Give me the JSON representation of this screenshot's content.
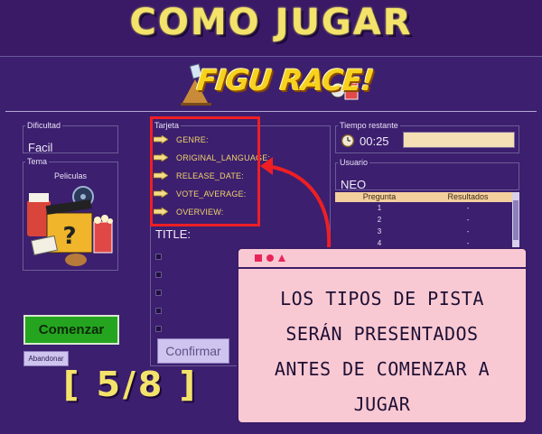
{
  "header": {
    "title": "COMO JUGAR"
  },
  "logo": {
    "text": "FIGU RACE!"
  },
  "dificultad": {
    "legend": "Dificultad",
    "value": "Facil"
  },
  "tema": {
    "legend": "Tema",
    "value": "Peliculas"
  },
  "tarjeta": {
    "legend": "Tarjeta",
    "hints": [
      "GENRE:",
      "ORIGINAL_LANGUAGE:",
      "RELEASE_DATE:",
      "VOTE_AVERAGE:",
      "OVERVIEW:"
    ],
    "title_label": "TITLE:"
  },
  "tiempo": {
    "legend": "Tiempo restante",
    "value": "00:25"
  },
  "usuario": {
    "legend": "Usuario",
    "value": "NEO"
  },
  "resultados": {
    "headers": [
      "Pregunta",
      "Resultados"
    ],
    "rows": [
      [
        "1",
        "-"
      ],
      [
        "2",
        "-"
      ],
      [
        "3",
        "-"
      ],
      [
        "4",
        "-"
      ]
    ]
  },
  "buttons": {
    "start": "Comenzar",
    "quit": "Abandonar",
    "confirm": "Confirmar"
  },
  "step": "[ 5/8 ]",
  "popup": {
    "lines": [
      "LOS TIPOS DE PISTA",
      "SERÁN PRESENTADOS",
      "ANTES DE COMENZAR A",
      "JUGAR"
    ]
  },
  "colors": {
    "accent": "#f3e36a",
    "highlight": "#ee1f24",
    "start_button": "#25a51f",
    "popup": "#f9c9d3"
  }
}
